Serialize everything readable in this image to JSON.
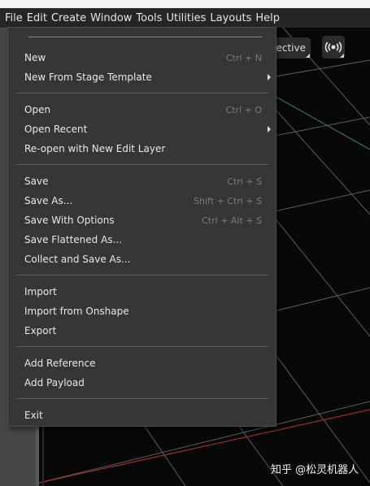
{
  "menubar": [
    "File",
    "Edit",
    "Create",
    "Window",
    "Tools",
    "Utilities",
    "Layouts",
    "Help"
  ],
  "viewport": {
    "camera_label": "pective"
  },
  "file_menu": {
    "items": [
      {
        "label": "New",
        "shortcut": "Ctrl + N",
        "submenu": false
      },
      {
        "label": "New From Stage Template",
        "shortcut": "",
        "submenu": true
      },
      {
        "label": "Open",
        "shortcut": "Ctrl + O",
        "submenu": false
      },
      {
        "label": "Open Recent",
        "shortcut": "",
        "submenu": true
      },
      {
        "label": "Re-open with New Edit Layer",
        "shortcut": "",
        "submenu": false
      },
      {
        "label": "Save",
        "shortcut": "Ctrl + S",
        "submenu": false
      },
      {
        "label": "Save As...",
        "shortcut": "Shift + Ctrl + S",
        "submenu": false
      },
      {
        "label": "Save With Options",
        "shortcut": "Ctrl + Alt + S",
        "submenu": false
      },
      {
        "label": "Save Flattened As...",
        "shortcut": "",
        "submenu": false
      },
      {
        "label": "Collect and Save As...",
        "shortcut": "",
        "submenu": false
      },
      {
        "label": "Import",
        "shortcut": "",
        "submenu": false
      },
      {
        "label": "Import from Onshape",
        "shortcut": "",
        "submenu": false
      },
      {
        "label": "Export",
        "shortcut": "",
        "submenu": false
      },
      {
        "label": "Add Reference",
        "shortcut": "",
        "submenu": false
      },
      {
        "label": "Add Payload",
        "shortcut": "",
        "submenu": false
      },
      {
        "label": "Exit",
        "shortcut": "",
        "submenu": false
      }
    ]
  },
  "watermark": "知乎 @松灵机器人",
  "colors": {
    "menu_bg": "#363636",
    "menubar_bg": "#262626",
    "viewport_bg": "#080808",
    "text": "#e8e8e8",
    "shortcut": "#7b7b7b"
  }
}
